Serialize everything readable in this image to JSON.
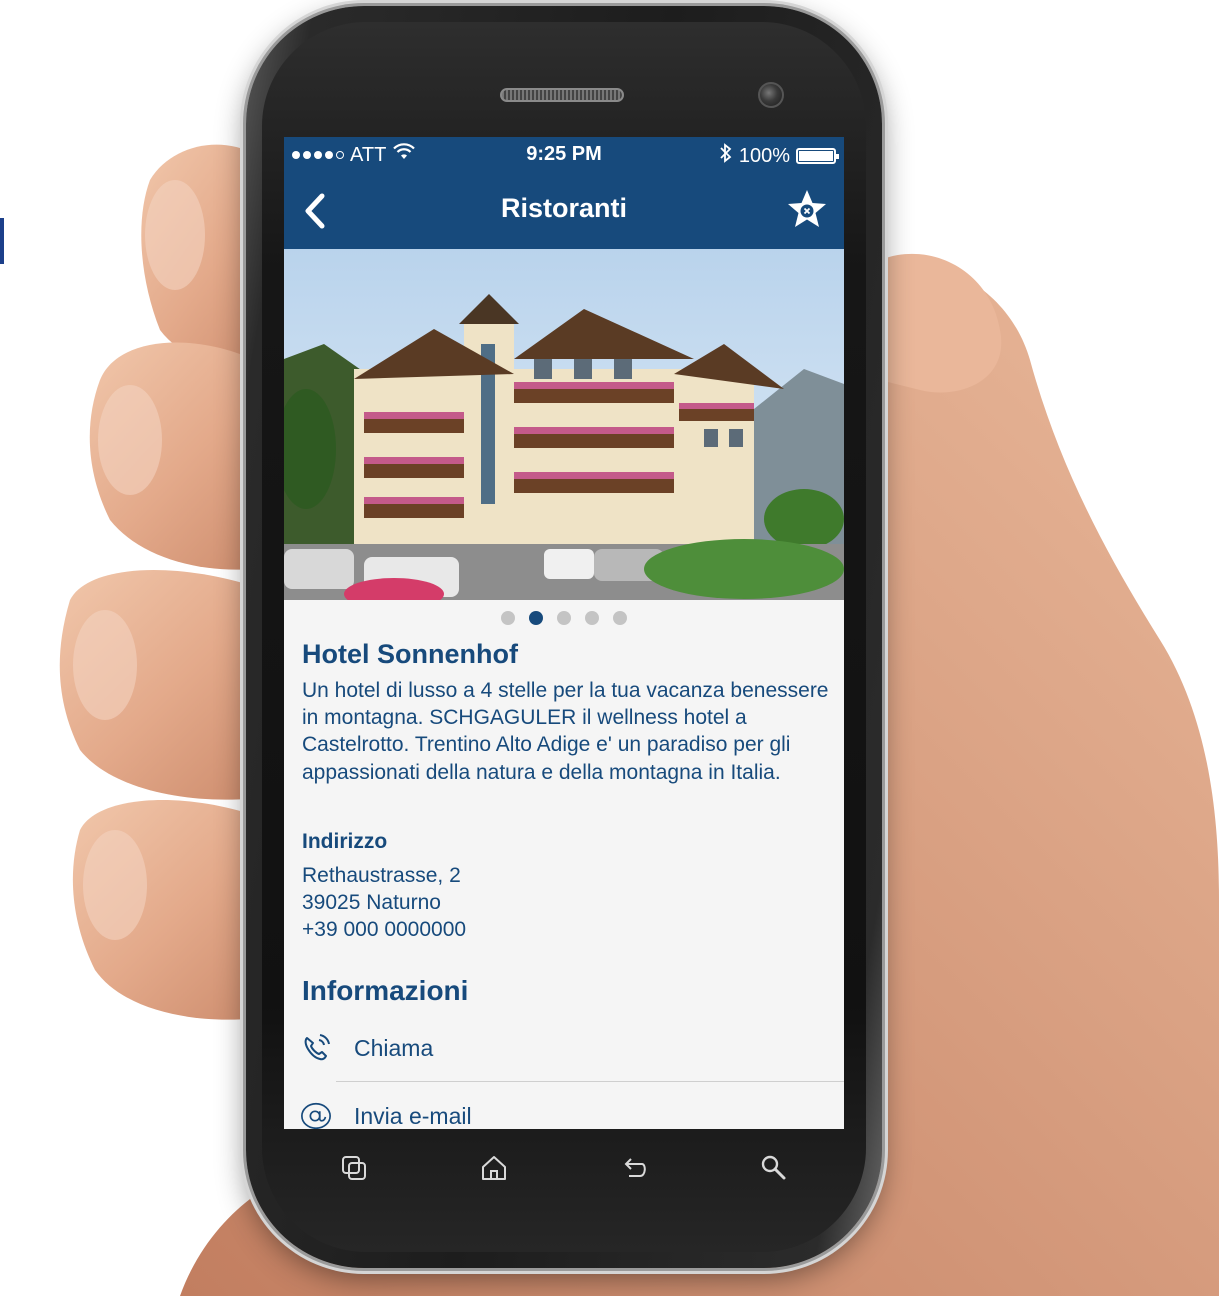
{
  "status_bar": {
    "carrier": "ATT",
    "time": "9:25 PM",
    "battery": "100%"
  },
  "header": {
    "title": "Ristoranti"
  },
  "gallery": {
    "total_images": 5,
    "active_index": 1
  },
  "hotel": {
    "name": "Hotel Sonnenhof",
    "description": "Un hotel di lusso a 4 stelle per la tua vacanza benessere in montagna. SCHGAGULER il wellness hotel a Castelrotto. Trentino Alto Adige e' un paradiso per gli appassionati della natura e della montagna in Italia."
  },
  "address": {
    "heading": "Indirizzo",
    "street": "Rethaustrasse, 2",
    "city": "39025 Naturno",
    "phone": "+39 000 0000000"
  },
  "info": {
    "heading": "Informazioni",
    "actions": [
      {
        "label": "Chiama",
        "icon": "phone-icon"
      },
      {
        "label": "Invia e-mail",
        "icon": "at-icon"
      }
    ]
  },
  "colors": {
    "primary": "#174a7c",
    "screen_background": "#f5f5f5",
    "dot_inactive": "#c4c4c4"
  },
  "device_keys": [
    {
      "icon": "recent-apps-icon"
    },
    {
      "icon": "home-icon"
    },
    {
      "icon": "back-arrow-icon"
    },
    {
      "icon": "search-icon"
    }
  ]
}
